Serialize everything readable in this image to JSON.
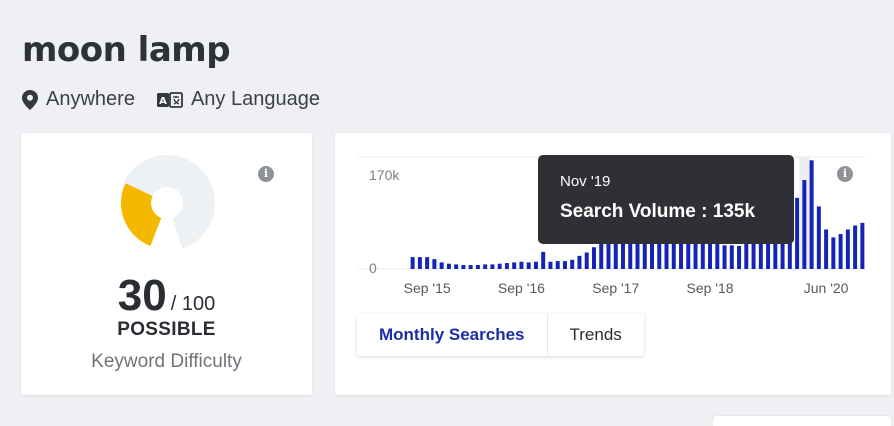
{
  "keyword": "moon lamp",
  "location": "Anywhere",
  "language": "Any Language",
  "difficulty": {
    "score": "30",
    "max": "/ 100",
    "level": "POSSIBLE",
    "label": "Keyword Difficulty",
    "fraction": 0.3,
    "colors": {
      "fill": "#f5b800",
      "track": "#eef1f4"
    }
  },
  "tabs": [
    "Monthly Searches",
    "Trends"
  ],
  "tooltip": {
    "date": "Nov '19",
    "text": "Search Volume : 135k"
  },
  "chart_data": {
    "type": "bar",
    "ylim": [
      0,
      170000
    ],
    "y_ticks": [
      "170k",
      "0"
    ],
    "x_ticks": [
      "Sep '15",
      "Sep '16",
      "Sep '17",
      "Sep '18",
      "Jun '20"
    ],
    "bar_color": "#1424b5",
    "highlighted_month": "Nov '19",
    "values": [
      18000,
      18000,
      18000,
      15000,
      10000,
      8000,
      7000,
      6000,
      6000,
      6000,
      7000,
      7000,
      8000,
      9000,
      10000,
      11000,
      10000,
      11000,
      26000,
      11000,
      12000,
      12000,
      14000,
      20000,
      25000,
      33000,
      40000,
      47000,
      52000,
      56000,
      58000,
      58000,
      58000,
      58000,
      58000,
      58000,
      58000,
      58000,
      48000,
      42000,
      38000,
      38000,
      38000,
      36000,
      36000,
      35000,
      38000,
      40000,
      46000,
      54000,
      64000,
      76000,
      92000,
      108000,
      135000,
      165000,
      95000,
      60000,
      48000,
      53000,
      60000,
      66000,
      70000
    ]
  }
}
